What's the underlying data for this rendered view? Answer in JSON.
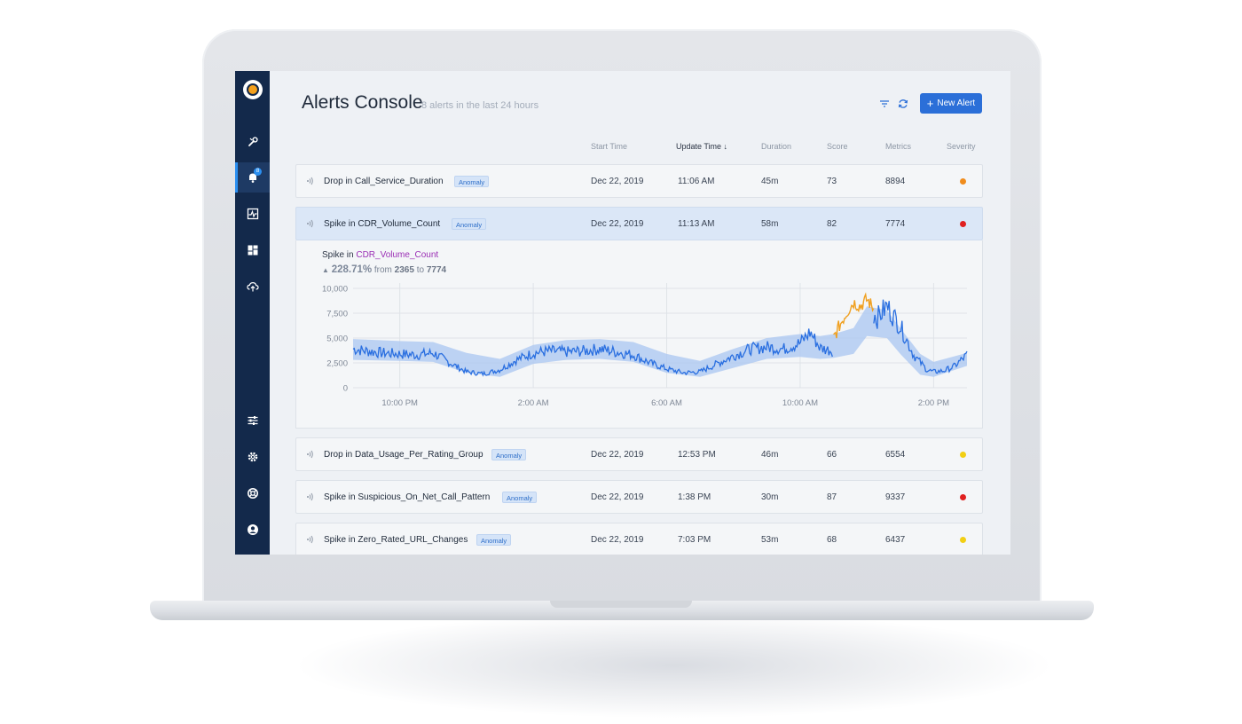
{
  "header": {
    "title": "Alerts Console",
    "subtitle": "8 alerts in the last 24 hours",
    "new_alert_label": "New Alert"
  },
  "sidebar": {
    "alerts_badge": "8",
    "items": [
      "wrench-icon",
      "bell-icon",
      "activity-icon",
      "dashboard-icon",
      "cloud-upload-icon",
      "sliders-icon",
      "gear-icon",
      "lifebuoy-icon",
      "user-icon"
    ]
  },
  "columns": {
    "start": "Start Time",
    "update": "Update Time",
    "duration": "Duration",
    "score": "Score",
    "metrics": "Metrics",
    "severity": "Severity"
  },
  "alerts": [
    {
      "name": "Drop in Call_Service_Duration",
      "tag": "Anomaly",
      "start": "Dec 22, 2019",
      "update": "11:06 AM",
      "duration": "45m",
      "score": "73",
      "metrics": "8894",
      "severity_color": "#f08c1c"
    },
    {
      "name": "Spike in CDR_Volume_Count",
      "tag": "Anomaly",
      "start": "Dec 22, 2019",
      "update": "11:13 AM",
      "duration": "58m",
      "score": "82",
      "metrics": "7774",
      "severity_color": "#e02020"
    },
    {
      "name": "Drop in Data_Usage_Per_Rating_Group",
      "tag": "Anomaly",
      "start": "Dec 22, 2019",
      "update": "12:53 PM",
      "duration": "46m",
      "score": "66",
      "metrics": "6554",
      "severity_color": "#f2cf14"
    },
    {
      "name": "Spike in Suspicious_On_Net_Call_Pattern",
      "tag": "Anomaly",
      "start": "Dec 22, 2019",
      "update": "1:38 PM",
      "duration": "30m",
      "score": "87",
      "metrics": "9337",
      "severity_color": "#e02020"
    },
    {
      "name": "Spike in Zero_Rated_URL_Changes",
      "tag": "Anomaly",
      "start": "Dec 22, 2019",
      "update": "7:03 PM",
      "duration": "53m",
      "score": "68",
      "metrics": "6437",
      "severity_color": "#f2cf14"
    }
  ],
  "detail": {
    "prefix": "Spike in",
    "metric": "CDR_Volume_Count",
    "percent": "228.71%",
    "from_word": "from",
    "from_value": "2365",
    "to_word": "to",
    "to_value": "7774"
  },
  "chart_data": {
    "type": "line",
    "y_ticks": [
      0,
      2500,
      5000,
      7500,
      10000
    ],
    "y_tick_labels": [
      "0",
      "2,500",
      "5,000",
      "7,500",
      "10,000"
    ],
    "x_tick_labels": [
      "10:00 PM",
      "2:00 AM",
      "6:00 AM",
      "10:00 AM",
      "2:00 PM"
    ],
    "x_tick_hours": [
      22,
      26,
      30,
      34,
      38
    ],
    "x_range_hours": [
      20.6,
      39.0
    ],
    "ylim": [
      0,
      10000
    ],
    "grid": true,
    "series": [
      {
        "role": "line",
        "color": "#2a6fe0",
        "x": [
          20.6,
          21,
          21.5,
          22,
          22.5,
          23,
          23.5,
          24,
          24.5,
          25,
          25.5,
          26,
          26.5,
          27,
          27.5,
          28,
          28.5,
          29,
          29.5,
          30,
          30.5,
          31,
          31.5,
          32,
          32.5,
          33,
          33.5,
          34,
          34.3,
          34.6,
          35,
          35.4,
          35.8,
          36,
          36.3,
          36.6,
          37,
          37.4,
          37.8,
          38,
          38.3,
          38.6,
          39
        ],
        "y": [
          3900,
          3700,
          3500,
          3400,
          3300,
          3500,
          2500,
          1600,
          1400,
          1800,
          2800,
          3500,
          3700,
          3600,
          3700,
          3900,
          3600,
          3300,
          2500,
          1900,
          1500,
          1600,
          2400,
          3200,
          3900,
          4100,
          3900,
          4500,
          5600,
          4000,
          3700,
          4000,
          7700,
          8400,
          7000,
          8200,
          6200,
          3300,
          1800,
          1600,
          1700,
          2100,
          3300
        ]
      },
      {
        "role": "anomaly",
        "color": "#f0a020",
        "x": [
          35.0,
          35.2,
          35.4,
          35.6,
          35.8,
          36.0,
          36.2
        ],
        "y": [
          5000,
          6400,
          7600,
          8600,
          8200,
          8900,
          8000
        ]
      },
      {
        "role": "expected-band",
        "color": "#a9c6f2",
        "x": [
          20.6,
          22,
          23,
          24,
          25,
          26,
          27,
          28,
          29,
          30,
          31,
          32,
          33,
          34,
          34.6,
          35,
          35.6,
          36,
          36.6,
          37,
          37.6,
          38,
          39
        ],
        "upper": [
          4900,
          4700,
          4600,
          3500,
          2900,
          4300,
          4800,
          4900,
          4600,
          3400,
          2700,
          3900,
          5000,
          5400,
          5200,
          5400,
          6000,
          8200,
          7800,
          6000,
          3400,
          2600,
          3500
        ],
        "lower": [
          2800,
          2700,
          2600,
          1500,
          1100,
          2400,
          2800,
          2900,
          2600,
          1500,
          1100,
          2000,
          2900,
          3100,
          2900,
          3000,
          3400,
          5200,
          5000,
          3400,
          1300,
          1100,
          2200
        ]
      }
    ]
  }
}
